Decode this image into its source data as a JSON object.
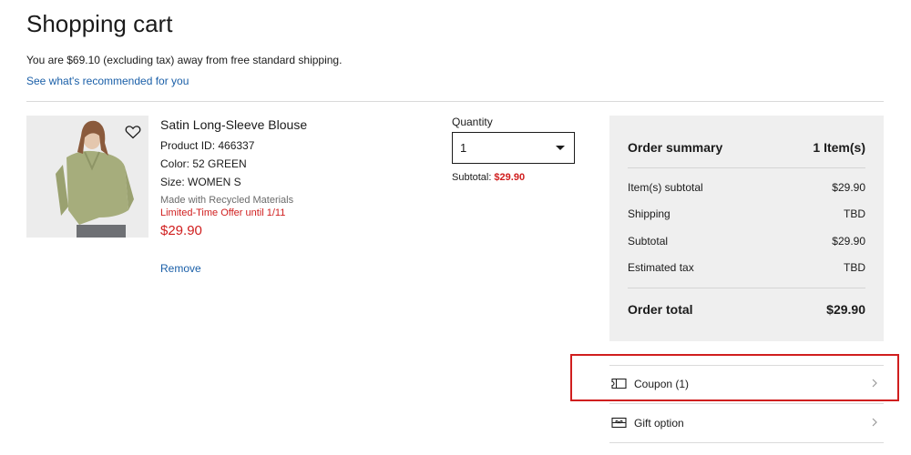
{
  "page": {
    "title": "Shopping cart",
    "shipping_note": "You are $69.10 (excluding tax) away from free standard shipping.",
    "recommend_link": "See what's recommended for you"
  },
  "cart_item": {
    "name": "Satin Long-Sleeve Blouse",
    "product_id": "Product ID: 466337",
    "color": "Color: 52 GREEN",
    "size": "Size: WOMEN S",
    "recycled_note": "Made with Recycled Materials",
    "offer_note": "Limited-Time Offer until 1/11",
    "price": "$29.90",
    "remove_label": "Remove",
    "quantity_label": "Quantity",
    "quantity_value": "1",
    "subtotal_label": "Subtotal:",
    "subtotal_value": "$29.90"
  },
  "order_summary": {
    "heading": "Order summary",
    "item_count": "1 Item(s)",
    "rows": [
      {
        "label": "Item(s) subtotal",
        "value": "$29.90"
      },
      {
        "label": "Shipping",
        "value": "TBD"
      },
      {
        "label": "Subtotal",
        "value": "$29.90"
      },
      {
        "label": "Estimated tax",
        "value": "TBD"
      }
    ],
    "total_label": "Order total",
    "total_value": "$29.90"
  },
  "options": {
    "coupon_label": "Coupon (1)",
    "gift_label": "Gift option"
  },
  "colors": {
    "link": "#1a5fa8",
    "sale_red": "#d01e1e",
    "summary_bg": "#efefef",
    "highlight": "#d01e1e"
  },
  "icons": {
    "wishlist": "heart-icon",
    "coupon": "ticket-icon",
    "gift": "gift-icon",
    "dropdown": "caret-down-icon",
    "row_arrow": "chevron-right-icon"
  }
}
